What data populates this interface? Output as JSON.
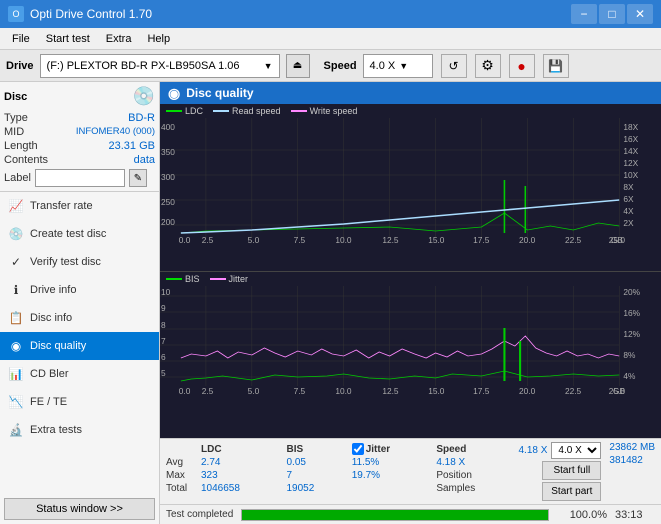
{
  "titleBar": {
    "title": "Opti Drive Control 1.70",
    "minBtn": "−",
    "maxBtn": "□",
    "closeBtn": "✕"
  },
  "menuBar": {
    "items": [
      "File",
      "Start test",
      "Extra",
      "Help"
    ]
  },
  "driveBar": {
    "label": "Drive",
    "driveValue": "(F:)  PLEXTOR BD-R  PX-LB950SA 1.06",
    "ejectIcon": "⏏",
    "speedLabel": "Speed",
    "speedValue": "4.0 X",
    "icons": [
      "↺",
      "💾",
      "🔴",
      "💾"
    ]
  },
  "sidebar": {
    "discSection": {
      "header": "Disc",
      "rows": [
        {
          "label": "Type",
          "value": "BD-R"
        },
        {
          "label": "MID",
          "value": "INFOMER40 (000)"
        },
        {
          "label": "Length",
          "value": "23.31 GB"
        },
        {
          "label": "Contents",
          "value": "data"
        },
        {
          "label": "Label",
          "value": ""
        }
      ]
    },
    "navItems": [
      {
        "id": "transfer-rate",
        "label": "Transfer rate",
        "icon": "📈"
      },
      {
        "id": "create-test-disc",
        "label": "Create test disc",
        "icon": "💿"
      },
      {
        "id": "verify-test-disc",
        "label": "Verify test disc",
        "icon": "✓"
      },
      {
        "id": "drive-info",
        "label": "Drive info",
        "icon": "ℹ"
      },
      {
        "id": "disc-info",
        "label": "Disc info",
        "icon": "📋"
      },
      {
        "id": "disc-quality",
        "label": "Disc quality",
        "icon": "◉",
        "active": true
      },
      {
        "id": "cd-bler",
        "label": "CD Bler",
        "icon": "📊"
      },
      {
        "id": "fe-te",
        "label": "FE / TE",
        "icon": "📉"
      },
      {
        "id": "extra-tests",
        "label": "Extra tests",
        "icon": "🔬"
      }
    ],
    "statusBtn": "Status window >>"
  },
  "discQuality": {
    "header": "Disc quality",
    "headerIcon": "◉",
    "chart1": {
      "legend": [
        {
          "label": "LDC",
          "color": "#00ff00"
        },
        {
          "label": "Read speed",
          "color": "#aaddff"
        },
        {
          "label": "Write speed",
          "color": "#ff88ff"
        }
      ],
      "yMax": 400,
      "yRight": [
        18,
        16,
        14,
        12,
        10,
        8,
        6,
        4,
        2
      ],
      "xLabels": [
        "0.0",
        "2.5",
        "5.0",
        "7.5",
        "10.0",
        "12.5",
        "15.0",
        "17.5",
        "20.0",
        "22.5",
        "25.0"
      ]
    },
    "chart2": {
      "legend": [
        {
          "label": "BIS",
          "color": "#00ff00"
        },
        {
          "label": "Jitter",
          "color": "#ff88ff"
        }
      ],
      "yMax": 10,
      "yRight": [
        20,
        16,
        12,
        8,
        4
      ],
      "xLabels": [
        "0.0",
        "2.5",
        "5.0",
        "7.5",
        "10.0",
        "12.5",
        "15.0",
        "17.5",
        "20.0",
        "22.5",
        "25.0"
      ]
    }
  },
  "stats": {
    "columns": [
      "",
      "LDC",
      "BIS",
      "",
      "Jitter",
      "Speed",
      "",
      ""
    ],
    "jitterChecked": true,
    "rows": [
      {
        "label": "Avg",
        "ldc": "2.74",
        "bis": "0.05",
        "jitter": "11.5%",
        "speed": "4.18 X",
        "speedDropdown": "4.0 X"
      },
      {
        "label": "Max",
        "ldc": "323",
        "bis": "7",
        "jitter": "19.7%",
        "position": "Position",
        "posValue": "23862 MB"
      },
      {
        "label": "Total",
        "ldc": "1046658",
        "bis": "19052",
        "jitter": "",
        "samples": "Samples",
        "samplesValue": "381482"
      }
    ],
    "startFullBtn": "Start full",
    "startPartBtn": "Start part"
  },
  "progressBar": {
    "percent": 100,
    "percentText": "100.0%",
    "status": "Test completed",
    "time": "33:13"
  }
}
